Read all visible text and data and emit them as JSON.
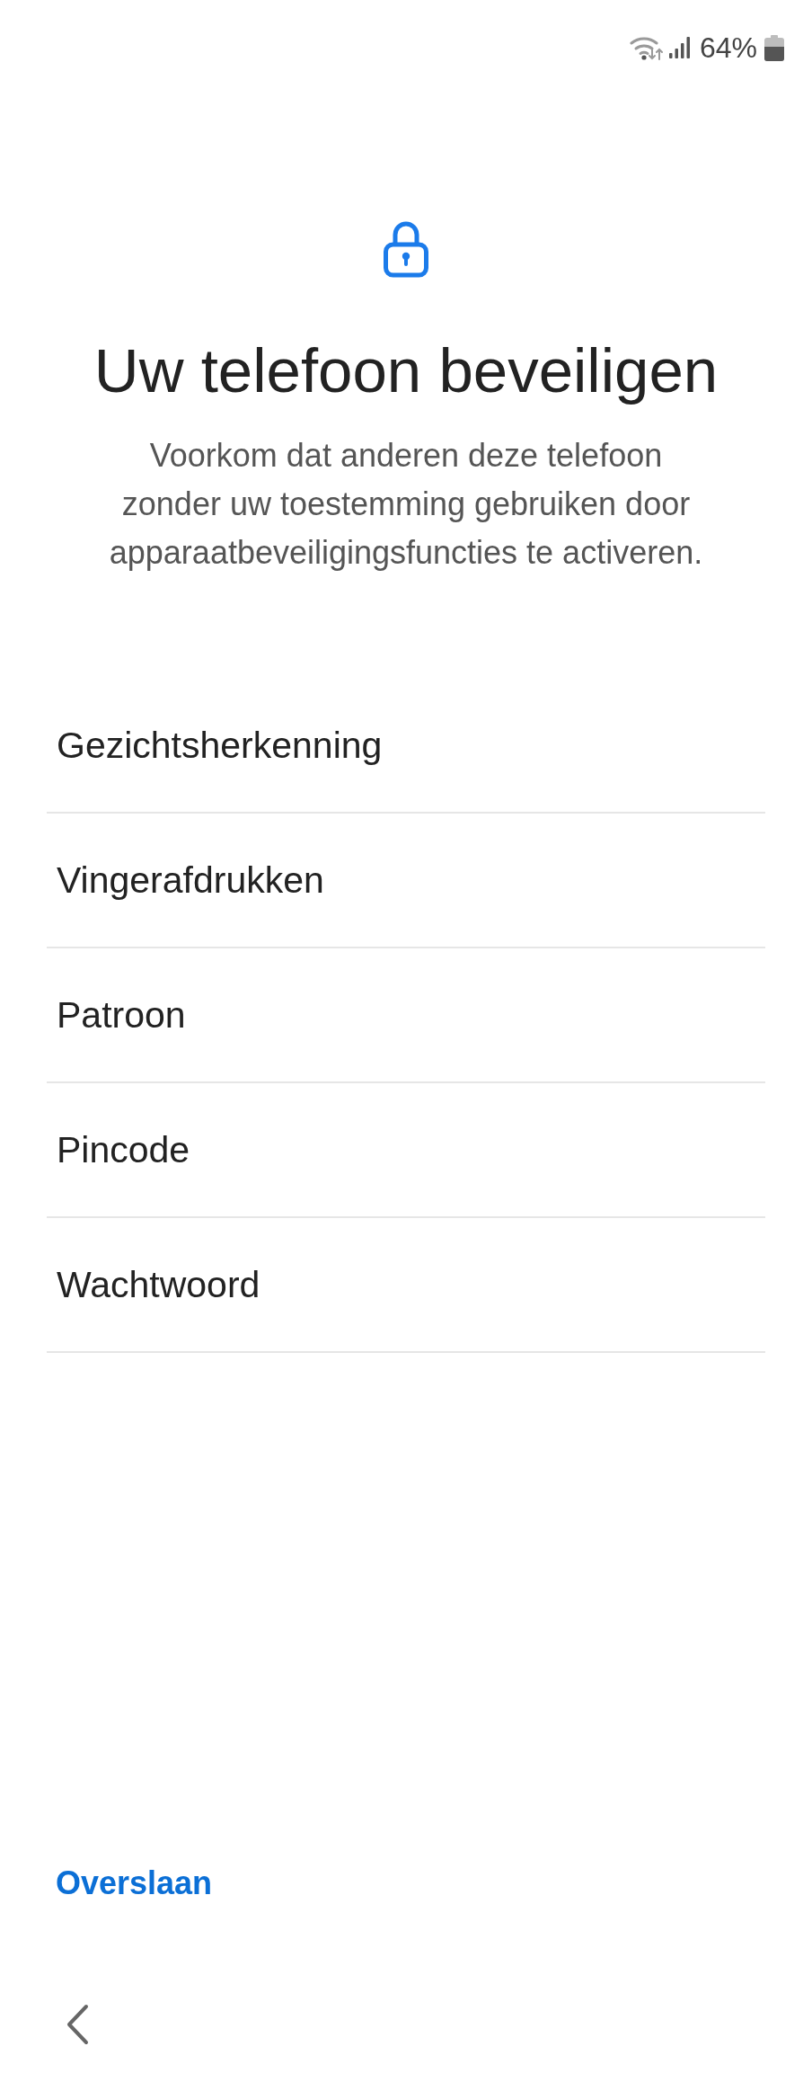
{
  "status_bar": {
    "battery_text": "64%"
  },
  "header": {
    "title": "Uw telefoon beveiligen",
    "description": "Voorkom dat anderen deze telefoon zonder uw toestemming gebruiken door apparaatbeveiligingsfuncties te activeren."
  },
  "options": [
    {
      "label": "Gezichtsherkenning"
    },
    {
      "label": "Vingerafdrukken"
    },
    {
      "label": "Patroon"
    },
    {
      "label": "Pincode"
    },
    {
      "label": "Wachtwoord"
    }
  ],
  "skip_button": {
    "label": "Overslaan"
  }
}
